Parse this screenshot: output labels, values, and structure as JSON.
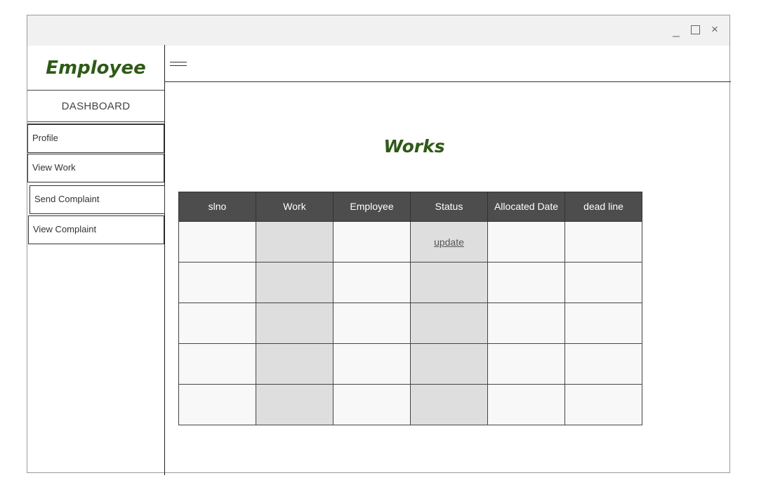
{
  "window": {
    "controls": {
      "minimize": "_",
      "maximize": "",
      "close": "×"
    }
  },
  "sidebar": {
    "brand": "Employee",
    "dashboard": "DASHBOARD",
    "items": [
      {
        "label": "Profile"
      },
      {
        "label": "View Work"
      },
      {
        "label": "Send Complaint"
      },
      {
        "label": "View Complaint"
      }
    ]
  },
  "main": {
    "title": "Works",
    "table": {
      "headers": [
        "slno",
        "Work",
        "Employee",
        "Status",
        "Allocated Date",
        "dead line"
      ],
      "rows": [
        [
          "",
          "",
          "",
          "update",
          "",
          ""
        ],
        [
          "",
          "",
          "",
          "",
          "",
          ""
        ],
        [
          "",
          "",
          "",
          "",
          "",
          ""
        ],
        [
          "",
          "",
          "",
          "",
          "",
          ""
        ],
        [
          "",
          "",
          "",
          "",
          "",
          ""
        ]
      ]
    }
  },
  "icons": {
    "menu": "hamburger-icon"
  },
  "colors": {
    "accent": "#2e5a16",
    "header_bg": "#4d4d4d",
    "shaded_cell": "#dedede"
  }
}
